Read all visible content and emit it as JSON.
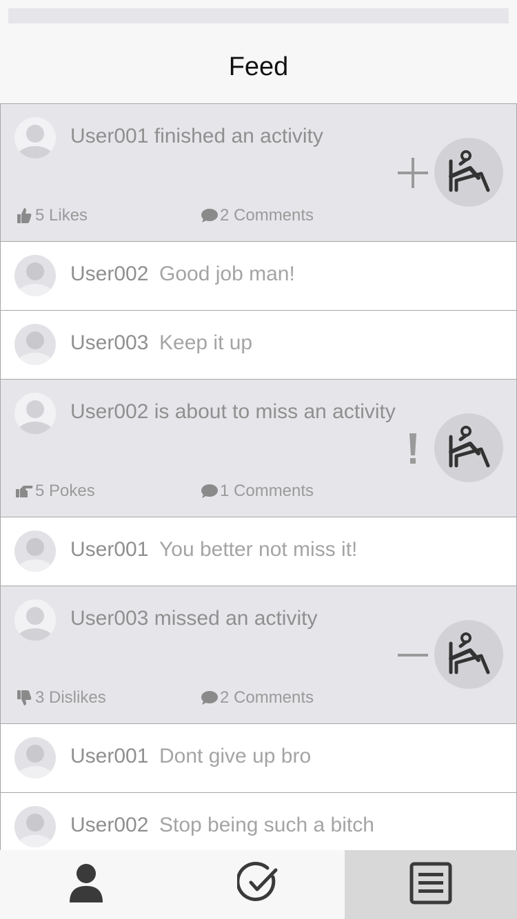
{
  "header": {
    "title": "Feed"
  },
  "feed": [
    {
      "kind": "activity",
      "text": "User001 finished an activity",
      "status": "plus",
      "reaction_icon": "thumbs-up-icon",
      "reaction_label": "5 Likes",
      "comments_label": "2 Comments"
    },
    {
      "kind": "comment",
      "user": "User002",
      "text": "Good job man!"
    },
    {
      "kind": "comment",
      "user": "User003",
      "text": "Keep it up"
    },
    {
      "kind": "activity",
      "text": "User002 is about to miss an activity",
      "status": "exclamation",
      "reaction_icon": "poke-hand-icon",
      "reaction_label": "5 Pokes",
      "comments_label": "1 Comments"
    },
    {
      "kind": "comment",
      "user": "User001",
      "text": "You better not miss it!"
    },
    {
      "kind": "activity",
      "text": "User003 missed an activity",
      "status": "minus",
      "reaction_icon": "thumbs-down-icon",
      "reaction_label": "3 Dislikes",
      "comments_label": "2 Comments"
    },
    {
      "kind": "comment",
      "user": "User001",
      "text": "Dont give up bro"
    },
    {
      "kind": "comment",
      "user": "User002",
      "text": "Stop being such a bitch"
    }
  ],
  "tabbar": {
    "tabs": [
      {
        "name": "profile",
        "icon": "person-icon"
      },
      {
        "name": "activities",
        "icon": "check-circle-icon"
      },
      {
        "name": "feed",
        "icon": "list-icon",
        "active": true
      }
    ]
  },
  "colors": {
    "activity_bg": "#e6e6ea",
    "comment_bg": "#ffffff",
    "text_gray": "#8f8f8f",
    "icon_dark": "#3a3a3a",
    "active_tab_bg": "#d8d8d8"
  }
}
